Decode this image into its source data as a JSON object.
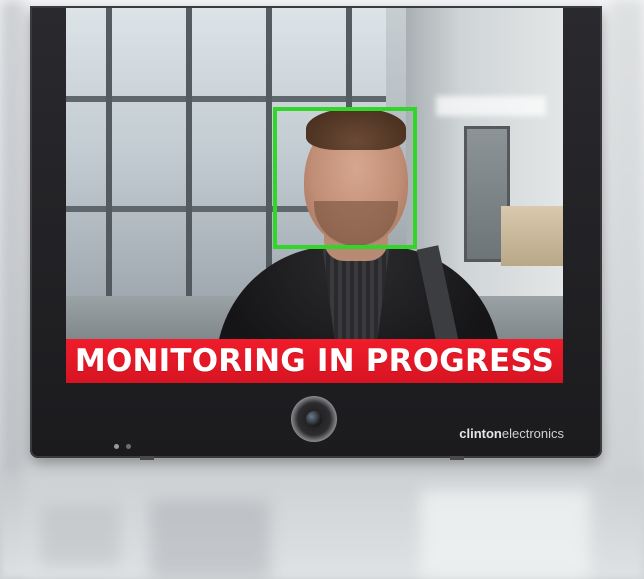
{
  "screen": {
    "banner_text": "MONITORING IN PROGRESS",
    "face_box_color": "#32d62a",
    "banner_color": "#e8192a"
  },
  "brand": {
    "bold": "clinton",
    "regular": "electronics"
  },
  "icons": {
    "camera": "camera-lens-icon",
    "status_led": "led-dot-icon"
  }
}
